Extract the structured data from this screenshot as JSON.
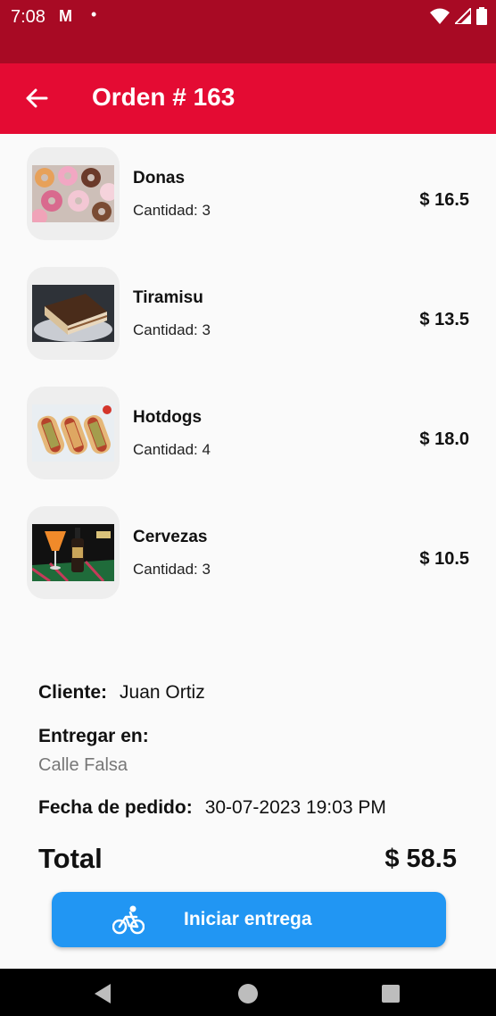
{
  "status_bar": {
    "time": "7:08",
    "gmail": "M",
    "dot": "•"
  },
  "app_bar": {
    "title": "Orden # 163"
  },
  "items": [
    {
      "name": "Donas",
      "quantity": "Cantidad: 3",
      "price": "$ 16.5",
      "image": "donuts-photo"
    },
    {
      "name": "Tiramisu",
      "quantity": "Cantidad: 3",
      "price": "$ 13.5",
      "image": "tiramisu-photo"
    },
    {
      "name": "Hotdogs",
      "quantity": "Cantidad: 4",
      "price": "$ 18.0",
      "image": "hotdogs-photo"
    },
    {
      "name": "Cervezas",
      "quantity": "Cantidad: 3",
      "price": "$ 10.5",
      "image": "beers-photo"
    }
  ],
  "details": {
    "client_label": "Cliente:",
    "client_value": "Juan Ortiz",
    "deliver_label": "Entregar en:",
    "deliver_value": "Calle Falsa",
    "date_label": "Fecha de pedido:",
    "date_value": "30-07-2023 19:03 PM"
  },
  "total": {
    "label": "Total",
    "value": "$ 58.5"
  },
  "start_button": {
    "label": "Iniciar entrega",
    "icon": "bicycle-icon"
  },
  "colors": {
    "status_bar": "#a80a24",
    "app_bar": "#e40b33",
    "button": "#2196f3"
  }
}
